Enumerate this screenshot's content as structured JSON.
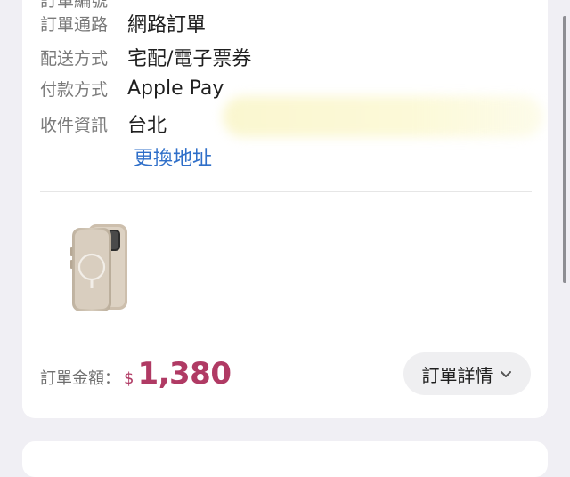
{
  "order": {
    "cut_row": {
      "label": "訂單編號",
      "value": ""
    },
    "channel": {
      "label": "訂單通路",
      "value": "網路訂單"
    },
    "delivery": {
      "label": "配送方式",
      "value": "宅配/電子票券"
    },
    "payment": {
      "label": "付款方式",
      "value": "Apple Pay"
    },
    "address": {
      "label": "收件資訊",
      "value": "台北"
    },
    "change_address_link": "更換地址",
    "product": {
      "image_icon": "phone-case-icon"
    },
    "total": {
      "label": "訂單金額：",
      "currency": "$",
      "amount": "1,380"
    },
    "detail_button": {
      "label": "訂單詳情",
      "icon": "chevron-down-icon"
    }
  },
  "colors": {
    "link": "#2f6fc9",
    "price": "#b03a64",
    "label": "#7a7a7a"
  }
}
